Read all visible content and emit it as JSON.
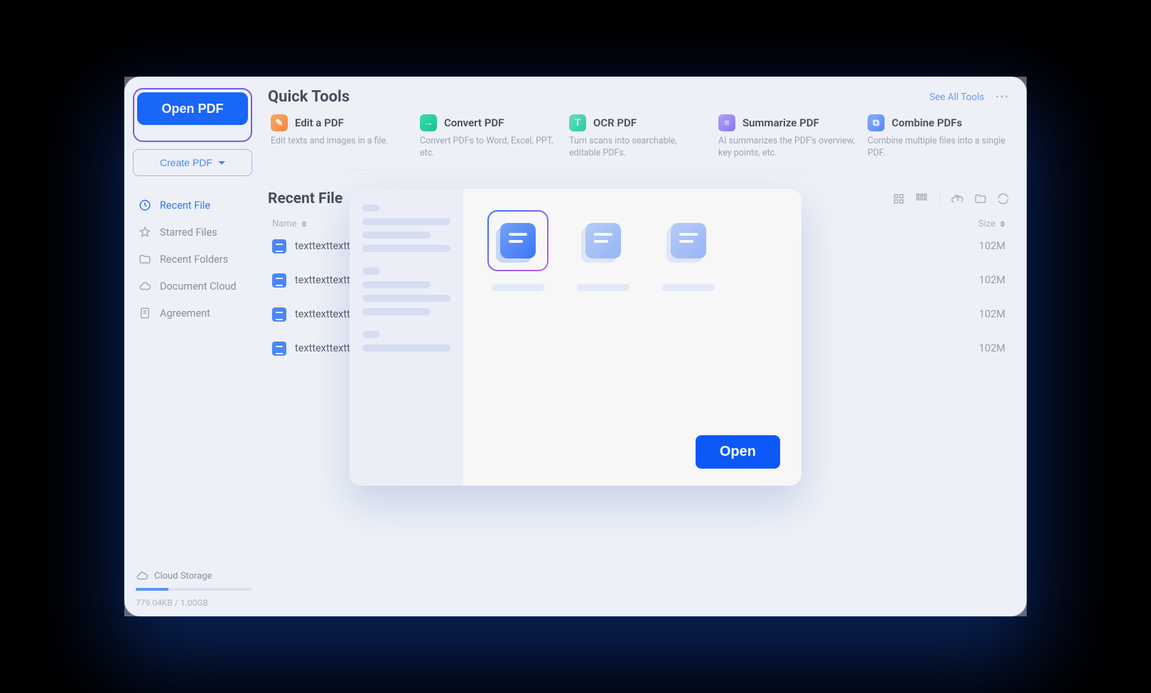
{
  "sidebar": {
    "open_pdf_label": "Open PDF",
    "create_pdf_label": "Create PDF",
    "nav": [
      {
        "id": "recent-file",
        "label": "Recent File",
        "active": true
      },
      {
        "id": "starred-files",
        "label": "Starred Files",
        "active": false
      },
      {
        "id": "recent-folders",
        "label": "Recent Folders",
        "active": false
      },
      {
        "id": "document-cloud",
        "label": "Document Cloud",
        "active": false
      },
      {
        "id": "agreement",
        "label": "Agreement",
        "active": false
      }
    ],
    "storage_label": "Cloud Storage",
    "storage_text": "779.04KB / 1.00GB"
  },
  "header": {
    "quick_tools_title": "Quick Tools",
    "see_all_label": "See All Tools"
  },
  "tools": [
    {
      "id": "edit",
      "title": "Edit a PDF",
      "desc": "Edit texts and images in a file."
    },
    {
      "id": "conv",
      "title": "Convert PDF",
      "desc": "Convert PDFs to Word, Excel, PPT, etc."
    },
    {
      "id": "ocr",
      "title": "OCR PDF",
      "desc": "Turn scans into searchable, editable PDFs."
    },
    {
      "id": "sum",
      "title": "Summarize PDF",
      "desc": "AI summarizes the PDF's overview, key points, etc."
    },
    {
      "id": "comb",
      "title": "Combine PDFs",
      "desc": "Combine multiple files into a single PDF."
    }
  ],
  "recent": {
    "title": "Recent File",
    "col_name": "Name",
    "col_size": "Size",
    "files": [
      {
        "name": "texttexttexttexttext",
        "size": "102M"
      },
      {
        "name": "texttexttexttexttext",
        "size": "102M"
      },
      {
        "name": "texttexttexttexttext",
        "size": "102M"
      },
      {
        "name": "texttexttexttexttext",
        "size": "102M"
      }
    ]
  },
  "modal": {
    "open_label": "Open"
  }
}
